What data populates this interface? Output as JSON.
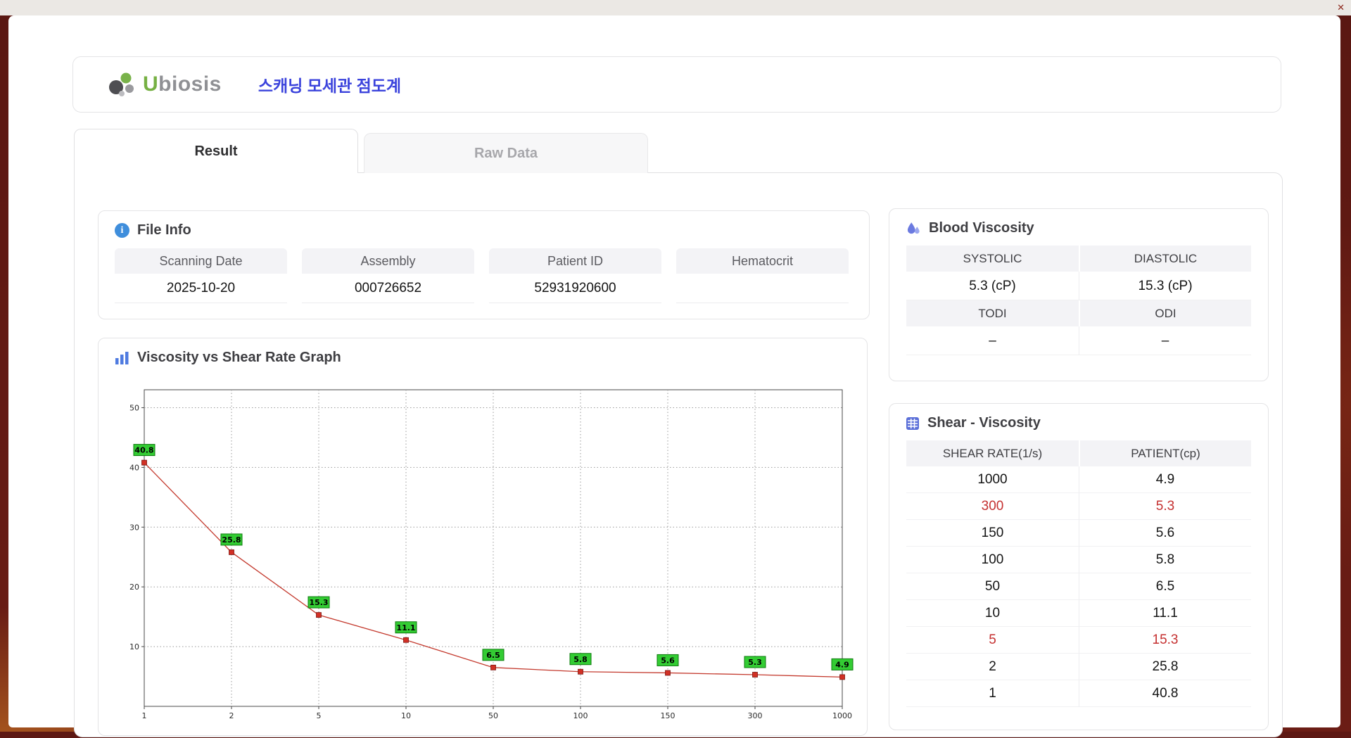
{
  "window": {
    "close_icon": "✕"
  },
  "header": {
    "logo_u": "U",
    "logo_rest": "biosis",
    "title": "스캐닝 모세관 점도계"
  },
  "tabs": [
    {
      "label": "Result"
    },
    {
      "label": "Raw Data"
    }
  ],
  "file_info": {
    "title": "File Info",
    "fields": [
      {
        "label": "Scanning Date",
        "value": "2025-10-20"
      },
      {
        "label": "Assembly",
        "value": "000726652"
      },
      {
        "label": "Patient ID",
        "value": "52931920600"
      },
      {
        "label": "Hematocrit",
        "value": ""
      }
    ]
  },
  "graph": {
    "title": "Viscosity vs Shear Rate Graph"
  },
  "blood_viscosity": {
    "title": "Blood Viscosity",
    "groups": [
      {
        "labels": [
          "SYSTOLIC",
          "DIASTOLIC"
        ],
        "values": [
          "5.3 (cP)",
          "15.3 (cP)"
        ]
      },
      {
        "labels": [
          "TODI",
          "ODI"
        ],
        "values": [
          "–",
          "–"
        ]
      }
    ]
  },
  "shear_viscosity": {
    "title": "Shear - Viscosity",
    "columns": [
      "SHEAR RATE(1/s)",
      "PATIENT(cp)"
    ],
    "rows": [
      {
        "cells": [
          "1000",
          "4.9"
        ],
        "highlight": false
      },
      {
        "cells": [
          "300",
          "5.3"
        ],
        "highlight": true
      },
      {
        "cells": [
          "150",
          "5.6"
        ],
        "highlight": false
      },
      {
        "cells": [
          "100",
          "5.8"
        ],
        "highlight": false
      },
      {
        "cells": [
          "50",
          "6.5"
        ],
        "highlight": false
      },
      {
        "cells": [
          "10",
          "11.1"
        ],
        "highlight": false
      },
      {
        "cells": [
          "5",
          "15.3"
        ],
        "highlight": true
      },
      {
        "cells": [
          "2",
          "25.8"
        ],
        "highlight": false
      },
      {
        "cells": [
          "1",
          "40.8"
        ],
        "highlight": false
      }
    ]
  },
  "chart_data": {
    "type": "line",
    "title": "Viscosity vs Shear Rate Graph",
    "x": [
      1,
      2,
      5,
      10,
      50,
      100,
      150,
      300,
      1000
    ],
    "x_axis_type": "category",
    "values": [
      40.8,
      25.8,
      15.3,
      11.1,
      6.5,
      5.8,
      5.6,
      5.3,
      4.9
    ],
    "ylim": [
      0,
      53
    ],
    "yticks": [
      10,
      20,
      30,
      40,
      50
    ],
    "grid": true,
    "legend": false,
    "xlabel": "",
    "ylabel": "",
    "line_color": "#c43a2e",
    "marker_color": "#d23025",
    "label_bg": "#33cc33",
    "label_border": "#0e7a0e"
  }
}
